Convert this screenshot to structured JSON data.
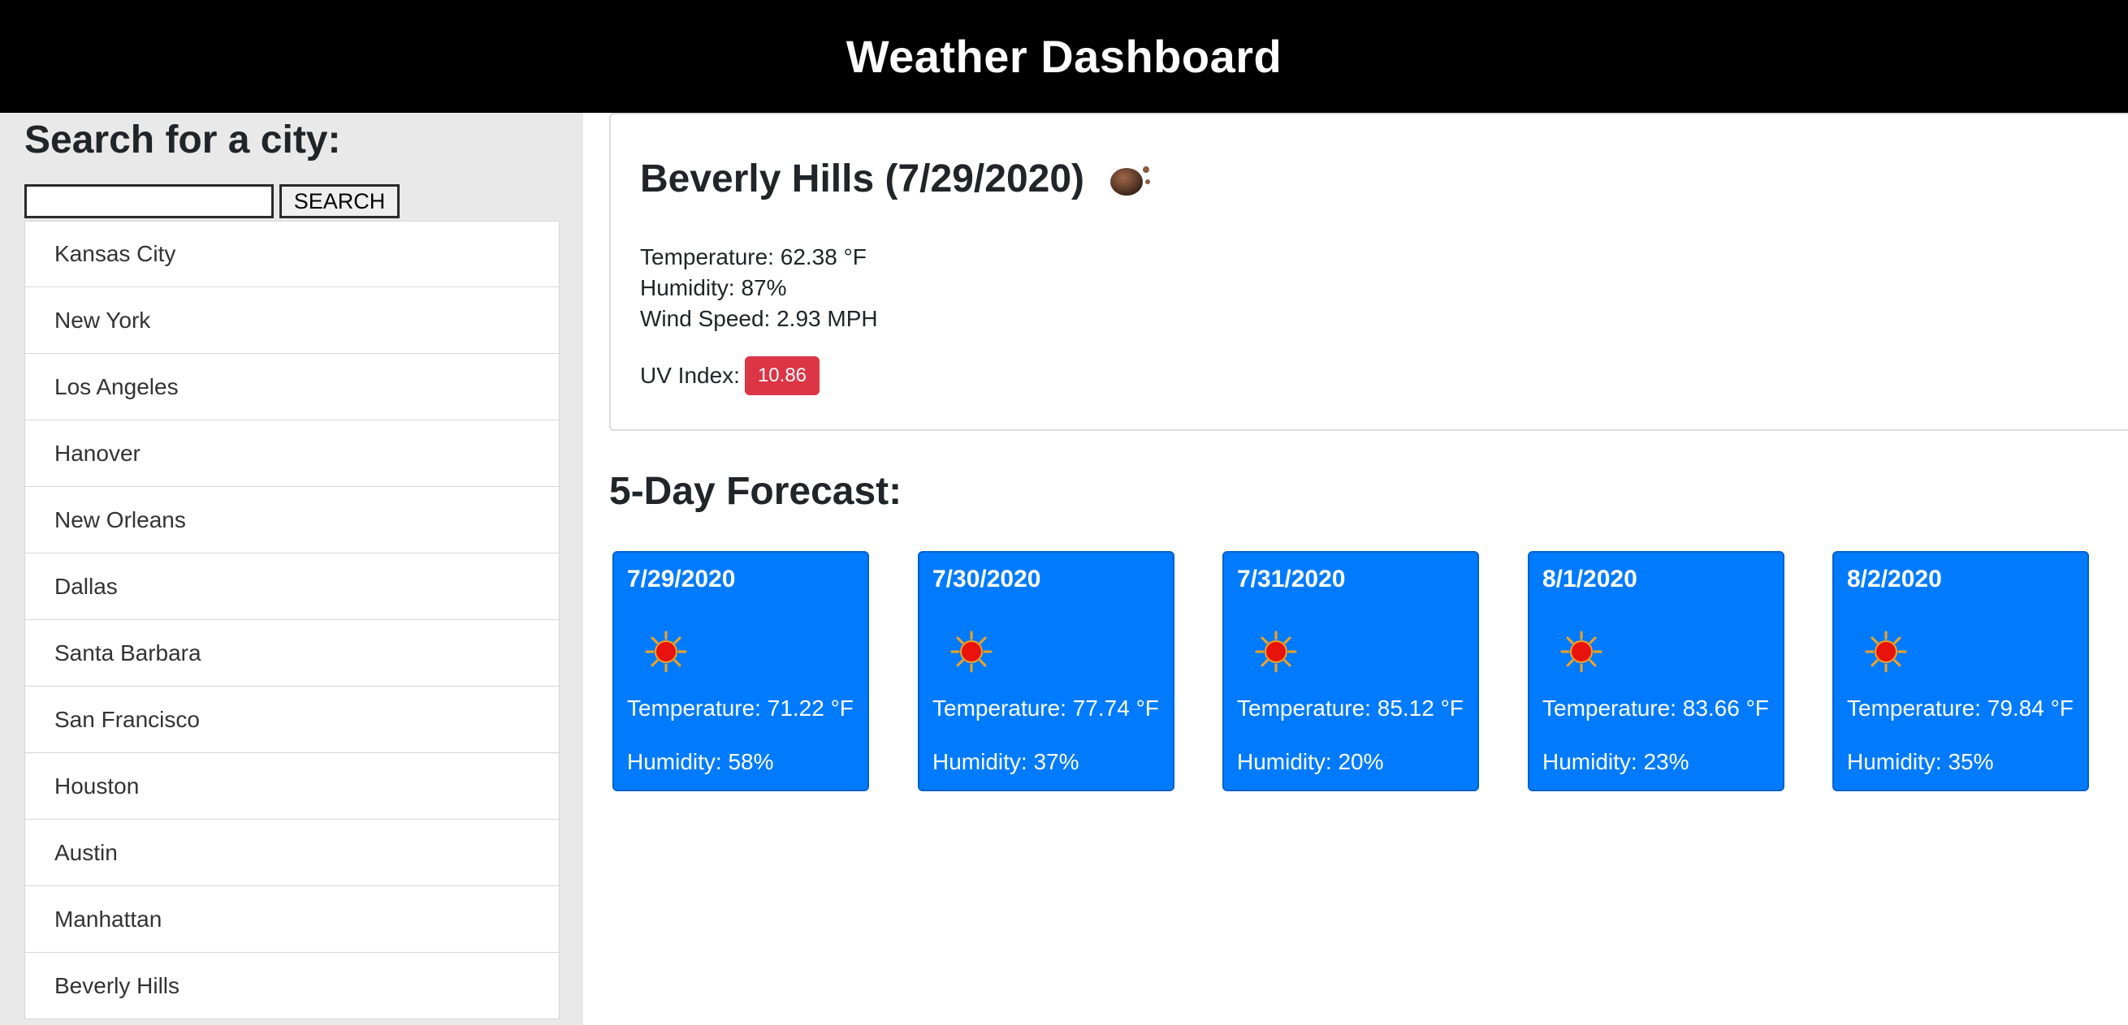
{
  "header": {
    "title": "Weather Dashboard"
  },
  "sidebar": {
    "heading": "Search for a city:",
    "search": {
      "value": "",
      "placeholder": "",
      "button_label": "SEARCH"
    },
    "cities": [
      "Kansas City",
      "New York",
      "Los Angeles",
      "Hanover",
      "New Orleans",
      "Dallas",
      "Santa Barbara",
      "San Francisco",
      "Houston",
      "Austin",
      "Manhattan",
      "Beverly Hills"
    ]
  },
  "current": {
    "title": "Beverly Hills (7/29/2020)",
    "icon": "clear-night-moon-icon",
    "temperature": "Temperature: 62.38 °F",
    "humidity": "Humidity: 87%",
    "wind": "Wind Speed: 2.93 MPH",
    "uv_label": "UV Index:",
    "uv_value": "10.86",
    "uv_color": "#dc3545"
  },
  "forecast": {
    "heading": "5-Day Forecast:",
    "card_color": "#007bff",
    "days": [
      {
        "date": "7/29/2020",
        "icon": "sun-icon",
        "temp": "Temperature: 71.22 °F",
        "humidity": "Humidity: 58%"
      },
      {
        "date": "7/30/2020",
        "icon": "sun-icon",
        "temp": "Temperature: 77.74 °F",
        "humidity": "Humidity: 37%"
      },
      {
        "date": "7/31/2020",
        "icon": "sun-icon",
        "temp": "Temperature: 85.12 °F",
        "humidity": "Humidity: 20%"
      },
      {
        "date": "8/1/2020",
        "icon": "sun-icon",
        "temp": "Temperature: 83.66 °F",
        "humidity": "Humidity: 23%"
      },
      {
        "date": "8/2/2020",
        "icon": "sun-icon",
        "temp": "Temperature: 79.84 °F",
        "humidity": "Humidity: 35%"
      }
    ]
  }
}
